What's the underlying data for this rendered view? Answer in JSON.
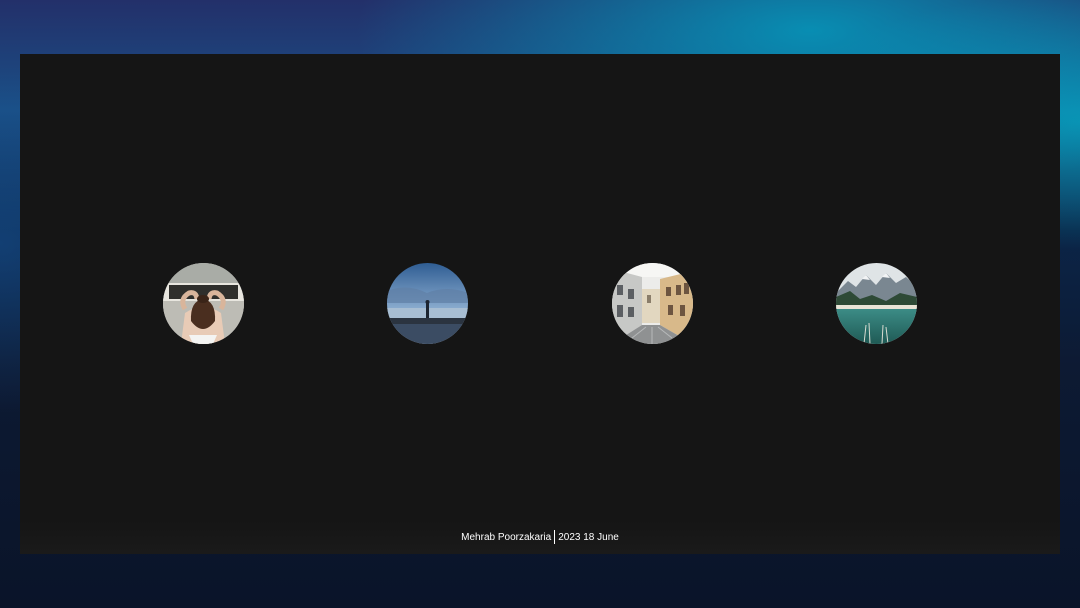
{
  "gallery": {
    "items": [
      {
        "icon": "woman-portrait-photo"
      },
      {
        "icon": "seaside-figure-photo"
      },
      {
        "icon": "old-town-street-photo"
      },
      {
        "icon": "mountain-lake-photo"
      }
    ]
  },
  "footer": {
    "author": "Mehrab Poorzakaria",
    "date": "2023 18 June"
  },
  "colors": {
    "panel": "#151515",
    "text": "#ffffff"
  }
}
